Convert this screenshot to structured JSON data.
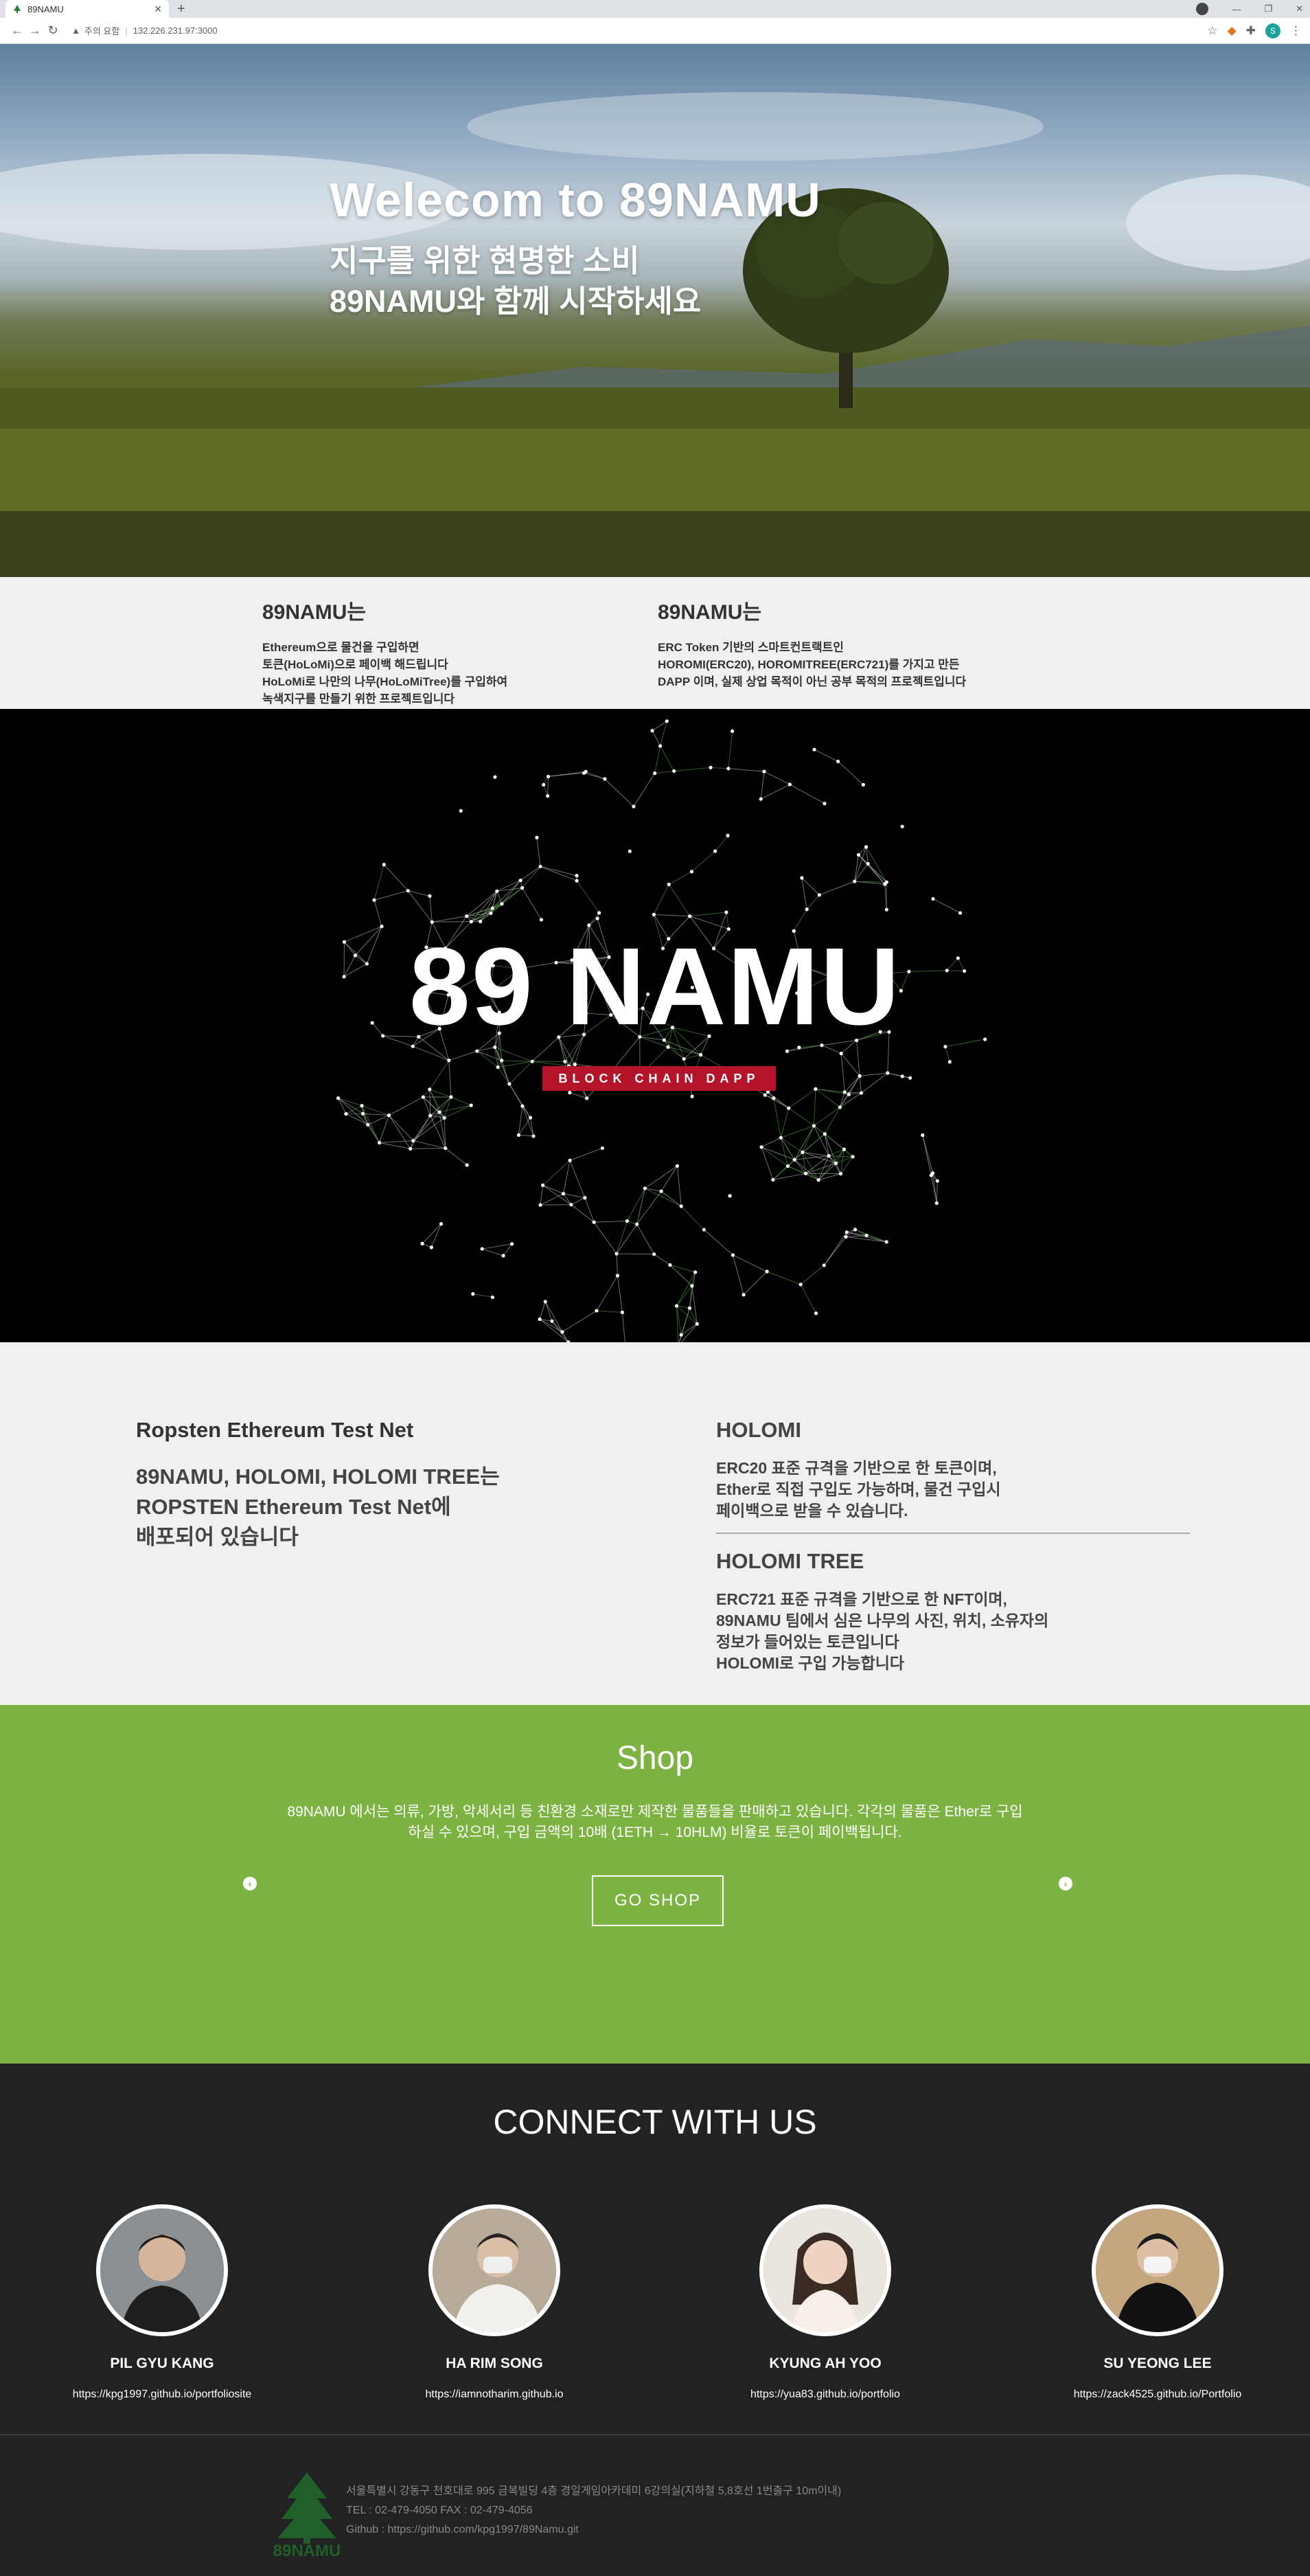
{
  "browser": {
    "tab_title": "89NAMU",
    "security_label": "주의 요함",
    "url": "132.226.231.97:3000",
    "profile_initial": "S"
  },
  "hero": {
    "title": "Welecom to 89NAMU",
    "subtitle_line1": "지구를 위한 현명한 소비",
    "subtitle_line2": "89NAMU와 함께 시작하세요"
  },
  "intro": {
    "left": {
      "heading": "89NAMU는",
      "lines": [
        "Ethereum으로 물건을 구입하면",
        "토큰(HoLoMi)으로 페이백 해드립니다",
        "HoLoMi로 나만의 나무(HoLoMiTree)를 구입하여",
        "녹색지구를 만들기 위한 프로젝트입니다"
      ]
    },
    "right": {
      "heading": "89NAMU는",
      "lines": [
        "ERC Token 기반의 스마트컨트랙트인",
        "HOROMI(ERC20), HOROMITREE(ERC721)를 가지고 만든",
        "DAPP 이며, 실제 상업 목적이 아닌 공부 목적의 프로젝트입니다"
      ]
    }
  },
  "network": {
    "title": "89 NAMU",
    "badge": "BLOCK CHAIN DAPP"
  },
  "info": {
    "left_heading": "Ropsten Ethereum Test Net",
    "left_lines": [
      "89NAMU, HOLOMI, HOLOMI TREE는",
      "ROPSTEN Ethereum Test Net에",
      "배포되어 있습니다"
    ],
    "holomi_heading": "HOLOMI",
    "holomi_lines": [
      "ERC20 표준 규격을 기반으로 한 토큰이며,",
      "Ether로 직접 구입도 가능하며, 물건 구입시",
      "페이백으로 받을 수 있습니다."
    ],
    "tree_heading": "HOLOMI TREE",
    "tree_lines": [
      "ERC721 표준 규격을 기반으로 한 NFT이며,",
      "89NAMU 팀에서 심은 나무의 사진, 위치, 소유자의",
      "정보가 들어있는 토큰입니다",
      "HOLOMI로 구입 가능합니다"
    ]
  },
  "shop": {
    "title": "Shop",
    "desc_line1": "89NAMU 에서는 의류, 가방, 악세서리 등 친환경 소재로만 제작한 물품들을 판매하고 있습니다. 각각의 물품은 Ether로 구입",
    "desc_line2": "하실 수 있으며, 구입 금액의 10배 (1ETH → 10HLM) 비율로 토큰이 페이백됩니다.",
    "button_label": "GO SHOP",
    "accent": "#7cb342"
  },
  "connect": {
    "title": "CONNECT WITH US",
    "members": [
      {
        "name": "PIL GYU KANG",
        "link": "https://kpg1997.github.io/portfoliosite"
      },
      {
        "name": "HA RIM SONG",
        "link": "https://iamnotharim.github.io"
      },
      {
        "name": "KYUNG AH YOO",
        "link": "https://yua83.github.io/portfolio"
      },
      {
        "name": "SU YEONG LEE",
        "link": "https://zack4525.github.io/Portfolio"
      }
    ]
  },
  "footer": {
    "logo_text": "89NAMU",
    "address": "서울특별시 강동구 천호대로 995 금복빌딩 4층 경일게임아카데미 6강의실(지하철 5,8호선 1번출구 10m이내)",
    "tel": "TEL : 02-479-4050 FAX : 02-479-4056",
    "github": "Github : https://github.com/kpg1997/89Namu.git"
  }
}
